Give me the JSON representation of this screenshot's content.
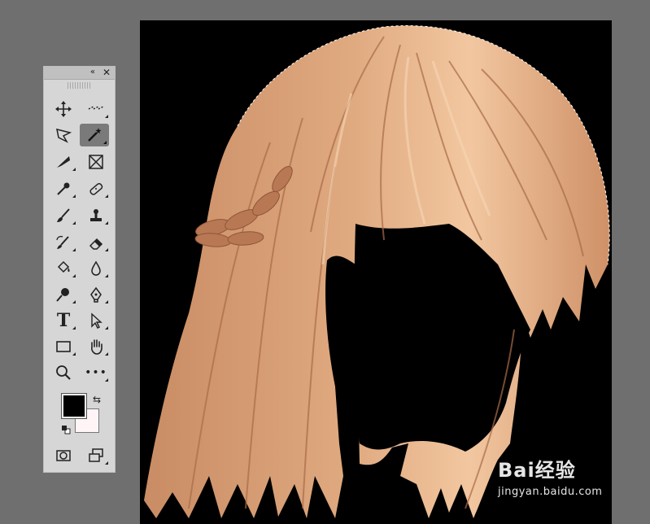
{
  "toolbox": {
    "collapse_glyph": "«",
    "close_glyph": "✕",
    "tools": [
      {
        "name": "move-tool",
        "icon": "move-icon",
        "active": false
      },
      {
        "name": "artboard-tool",
        "icon": "marquee-dots-icon",
        "active": false
      },
      {
        "name": "polygonal-lasso-tool",
        "icon": "lasso-icon",
        "active": false
      },
      {
        "name": "magic-wand-tool",
        "icon": "magic-wand-icon",
        "active": true
      },
      {
        "name": "slice-tool",
        "icon": "knife-icon",
        "active": false
      },
      {
        "name": "frame-tool",
        "icon": "frame-icon",
        "active": false
      },
      {
        "name": "eyedropper-tool",
        "icon": "eyedropper-icon",
        "active": false
      },
      {
        "name": "healing-brush-tool",
        "icon": "bandage-icon",
        "active": false
      },
      {
        "name": "brush-tool",
        "icon": "brush-icon",
        "active": false
      },
      {
        "name": "clone-stamp-tool",
        "icon": "stamp-icon",
        "active": false
      },
      {
        "name": "history-brush-tool",
        "icon": "history-brush-icon",
        "active": false
      },
      {
        "name": "eraser-tool",
        "icon": "eraser-icon",
        "active": false
      },
      {
        "name": "paint-bucket-tool",
        "icon": "bucket-icon",
        "active": false
      },
      {
        "name": "blur-tool",
        "icon": "drop-icon",
        "active": false
      },
      {
        "name": "dodge-tool",
        "icon": "dodge-icon",
        "active": false
      },
      {
        "name": "pen-tool",
        "icon": "pen-icon",
        "active": false
      },
      {
        "name": "type-tool",
        "icon": "type-icon",
        "label": "T",
        "active": false
      },
      {
        "name": "path-selection-tool",
        "icon": "arrow-icon",
        "active": false
      },
      {
        "name": "rectangle-tool",
        "icon": "rectangle-icon",
        "active": false
      },
      {
        "name": "hand-tool",
        "icon": "hand-icon",
        "active": false
      },
      {
        "name": "zoom-tool",
        "icon": "zoom-icon",
        "active": false
      },
      {
        "name": "more-tools",
        "icon": "ellipsis-icon",
        "label": "•••",
        "active": false
      },
      {
        "name": "quick-mask",
        "icon": "quick-mask-icon",
        "active": false
      },
      {
        "name": "screen-mode",
        "icon": "screen-mode-icon",
        "active": false
      }
    ],
    "foreground_color": "#000000",
    "background_color": "#fff5f6"
  },
  "canvas": {
    "background": "#000000",
    "hair_color": "#d9a27a",
    "hair_shadow": "#b97a57",
    "hair_highlight": "#f4c9a3"
  },
  "watermark": {
    "main": "Bai经验",
    "sub": "jingyan.baidu.com"
  }
}
